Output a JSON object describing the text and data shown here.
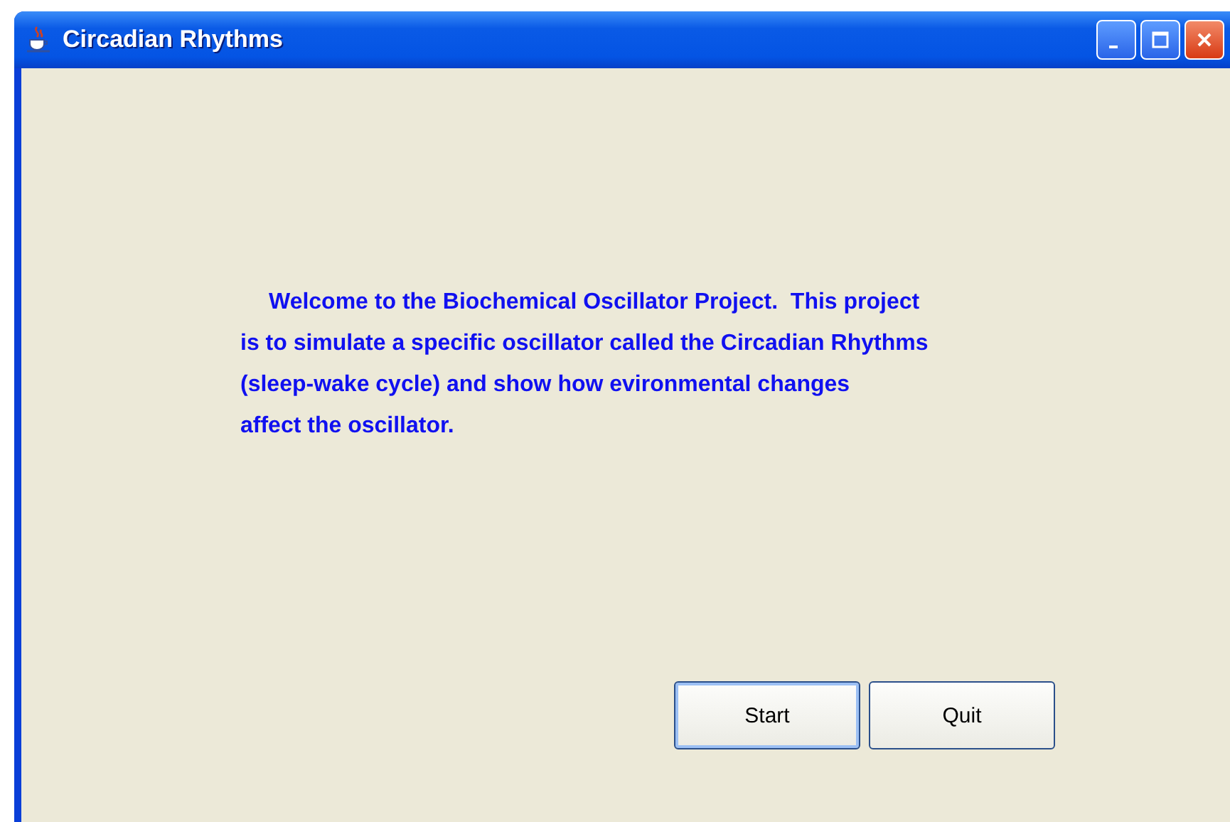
{
  "window": {
    "title": "Circadian Rhythms"
  },
  "message": {
    "lines": [
      "Welcome to the Biochemical Oscillator Project.  This project",
      "is to simulate a specific oscillator called the Circadian Rhythms",
      "(sleep-wake cycle) and show how evironmental changes",
      "affect the oscillator."
    ]
  },
  "buttons": [
    {
      "label": "Start",
      "focused": true
    },
    {
      "label": "Quit",
      "focused": false
    }
  ]
}
